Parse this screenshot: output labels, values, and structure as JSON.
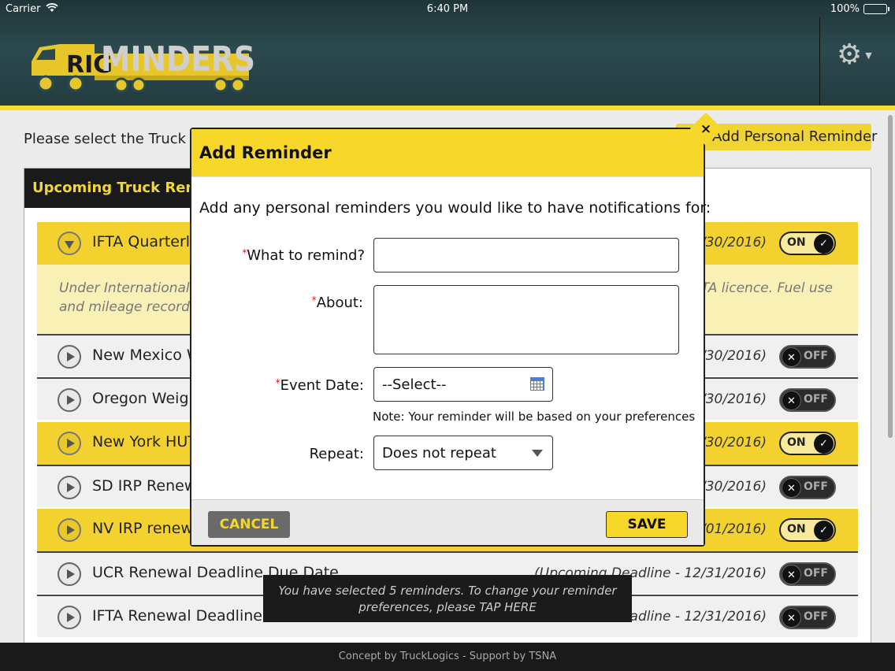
{
  "status_bar": {
    "carrier": "Carrier",
    "time": "6:40 PM",
    "battery": "100%"
  },
  "header": {
    "logo_left": "RIG",
    "logo_right": "MINDERS"
  },
  "main": {
    "instruction": "Please select the Truck D",
    "add_personal_button": "Add Personal Reminder",
    "panel_title": "Upcoming Truck Remi"
  },
  "reminders": [
    {
      "title": "IFTA Quarterly",
      "date": "/30/2016)",
      "toggle": "ON",
      "expanded": true
    },
    {
      "title": "New Mexico W",
      "date": "/30/2016)",
      "toggle": "OFF"
    },
    {
      "title": "Oregon Weigh",
      "date": "/30/2016)",
      "toggle": "OFF"
    },
    {
      "title": "New York HUT",
      "date": "/30/2016)",
      "toggle": "ON"
    },
    {
      "title": "SD IRP Renew",
      "date": "/30/2016)",
      "toggle": "OFF"
    },
    {
      "title": "NV IRP renew",
      "date": "/01/2016)",
      "toggle": "ON"
    },
    {
      "title": "UCR Renewal Deadline Due Date",
      "date": "(Upcoming Deadline - 12/31/2016)",
      "toggle": "OFF"
    },
    {
      "title": "IFTA Renewal Deadline D",
      "date": "eadline - 12/31/2016)",
      "toggle": "OFF"
    }
  ],
  "description": {
    "line1_left": "Under International F",
    "line2_left": "and mileage records p",
    "line1_right": "IFTA licence. Fuel use"
  },
  "modal": {
    "title": "Add Reminder",
    "close": "×",
    "prompt": "Add any personal reminders you would like to have notifications for:",
    "what_label": "What to remind?",
    "what_value": "",
    "about_label": "About:",
    "about_value": "",
    "event_date_label": "Event Date:",
    "event_date_value": "--Select--",
    "note": "Note: Your reminder will be based on your preferences",
    "repeat_label": "Repeat:",
    "repeat_value": "Does not repeat",
    "cancel": "CANCEL",
    "save": "SAVE"
  },
  "toast": {
    "line1": "You have selected 5 reminders. To change your reminder",
    "line2": "preferences, please TAP HERE"
  },
  "footer": "Concept by TruckLogics - Support by TSNA",
  "colors": {
    "accent_yellow": "#f6d72a",
    "header_bg": "#2b4a4f",
    "dark": "#1a1a1a"
  }
}
